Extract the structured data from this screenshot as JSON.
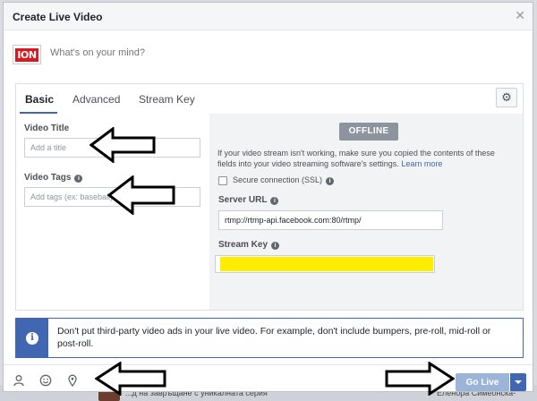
{
  "background": {
    "left_text": "...д на завръщане с уникалната серия",
    "right_text": "Еленора Симеонска-"
  },
  "dialog": {
    "title": "Create Live Video",
    "close_icon": "close-icon"
  },
  "composer": {
    "logo_text": "ION",
    "placeholder": "What's on your mind?"
  },
  "tabs": [
    {
      "label": "Basic",
      "active": true
    },
    {
      "label": "Advanced",
      "active": false
    },
    {
      "label": "Stream Key",
      "active": false
    }
  ],
  "settings_icon": "gear-icon",
  "form": {
    "video_title_label": "Video Title",
    "video_title_placeholder": "Add a title",
    "video_tags_label": "Video Tags",
    "video_tags_placeholder": "Add tags (ex: baseball)"
  },
  "stream": {
    "status": "OFFLINE",
    "help_text": "If your video stream isn't working, make sure you copied the contents of these fields into your video streaming software's settings.",
    "learn_more": "Learn more",
    "secure_label": "Secure connection (SSL)",
    "server_url_label": "Server URL",
    "server_url_value": "rtmp://rtmp-api.facebook.com:80/rtmp/",
    "stream_key_label": "Stream Key",
    "stream_key_highlight": "#ffed00"
  },
  "notice": {
    "text": "Don't put third-party video ads in your live video. For example, don't include bumpers, pre-roll, mid-roll or post-roll."
  },
  "footer": {
    "icons": [
      "tag-people-icon",
      "emoji-icon",
      "location-pin-icon"
    ],
    "go_live_label": "Go Live",
    "accent": "#4267b2"
  }
}
